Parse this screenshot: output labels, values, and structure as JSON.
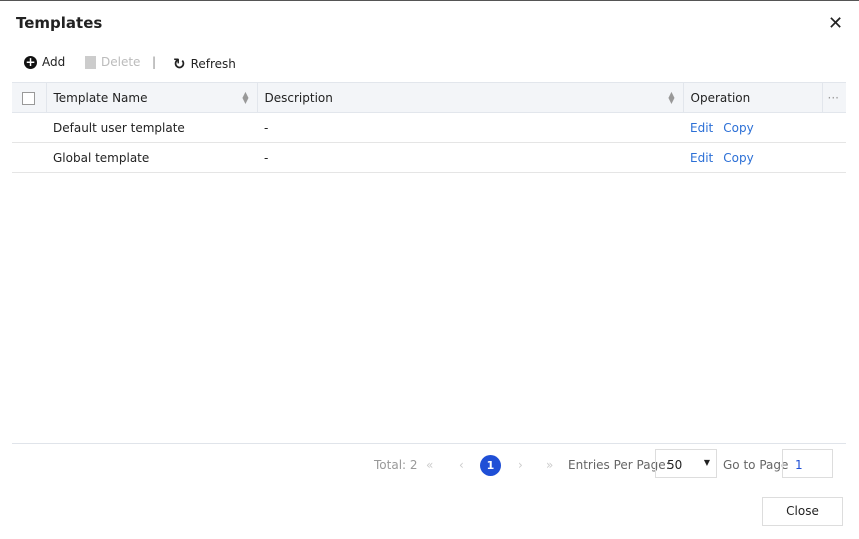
{
  "dialog": {
    "title": "Templates",
    "close_icon": "✕"
  },
  "toolbar": {
    "add": "Add",
    "delete": "Delete",
    "separator": "|",
    "refresh": "Refresh"
  },
  "table": {
    "columns": [
      "Template Name",
      "Description",
      "Operation"
    ],
    "rows": [
      {
        "name": "Default user template",
        "description": "-",
        "edit": "Edit",
        "copy": "Copy"
      },
      {
        "name": "Global template",
        "description": "-",
        "edit": "Edit",
        "copy": "Copy"
      }
    ]
  },
  "pagination": {
    "total": "Total: 2",
    "first": "«",
    "prev": "‹",
    "current": "1",
    "next": "›",
    "last": "»",
    "per_page_label": "Entries Per Page:",
    "per_page": "50",
    "goto_label": "Go to Page",
    "goto_value": "1"
  },
  "footer": {
    "close": "Close"
  },
  "colors": {
    "accent": "#1f4fd6",
    "link": "#2b6fd6"
  }
}
